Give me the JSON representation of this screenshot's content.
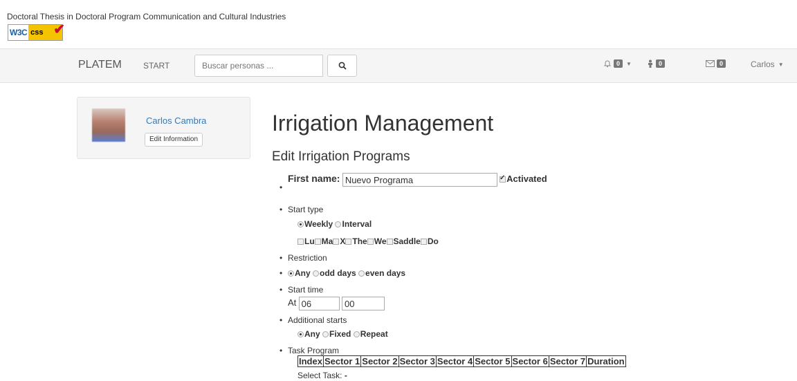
{
  "header": {
    "title": "Doctoral Thesis in Doctoral Program Communication and Cultural Industries",
    "w3c_badge": {
      "w3": "W3C",
      "css": "css"
    }
  },
  "navbar": {
    "brand": "PLATEM",
    "start": "START",
    "search_placeholder": "Buscar personas ...",
    "notifications_count": "0",
    "requests_count": "0",
    "messages_count": "0",
    "user": "Carlos"
  },
  "profile": {
    "name": "Carlos Cambra",
    "edit_label": "Edit Information"
  },
  "main": {
    "title": "Irrigation Management",
    "subtitle": "Edit Irrigation Programs"
  },
  "form": {
    "first_name_label": "First name:",
    "first_name_value": "Nuevo Programa",
    "activated_label": "Activated",
    "start_type_label": "Start type",
    "start_type_options": [
      "Weekly",
      "Interval"
    ],
    "days": [
      "Lu",
      "Ma",
      "X",
      "The",
      "We",
      "Saddle",
      "Do"
    ],
    "restriction_label": "Restriction",
    "restriction_options": [
      "Any",
      "odd days",
      "even days"
    ],
    "start_time_label": "Start time",
    "at_label": "At",
    "hour_value": "06",
    "minute_value": "00",
    "additional_starts_label": "Additional starts",
    "additional_options": [
      "Any",
      "Fixed",
      "Repeat"
    ],
    "task_program_label": "Task Program",
    "task_columns": [
      "Index",
      "Sector 1",
      "Sector 2",
      "Sector 3",
      "Sector 4",
      "Sector 5",
      "Sector 6",
      "Sector 7",
      "Duration"
    ],
    "select_task_label": "Select Task:",
    "select_task_value": "-"
  },
  "colors": {
    "link": "#337ab7",
    "navbar_bg": "#f5f5f5",
    "badge": "#777777",
    "w3c_yellow": "#f5c400"
  }
}
